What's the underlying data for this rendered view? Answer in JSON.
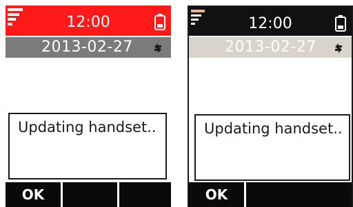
{
  "screens": [
    {
      "variant": "red-theme",
      "time": "12:00",
      "date": "2013-02-27",
      "message": "Updating handset..",
      "softkeys": [
        "OK",
        "",
        ""
      ],
      "colors": {
        "statusbar": "#ff1a1a",
        "datebar": "#7b7b7b",
        "softkeys": "#0a0a0a"
      },
      "icons": [
        "signal-icon",
        "battery-icon",
        "sync-icon"
      ]
    },
    {
      "variant": "dark-theme",
      "time": "12:00",
      "date": "2013-02-27",
      "message": "Updating handset..",
      "softkeys": [
        "OK",
        ""
      ],
      "colors": {
        "statusbar": "#111111",
        "datebar": "#d8d4cc",
        "softkeys": "#0a0a0a"
      },
      "icons": [
        "signal-icon",
        "battery-icon",
        "sync-icon"
      ]
    }
  ]
}
